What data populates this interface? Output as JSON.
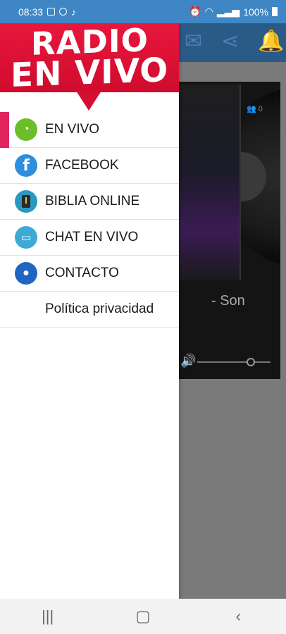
{
  "status_bar": {
    "time": "08:33",
    "battery": "100%"
  },
  "background_app": {
    "listener_count": "0",
    "song_text": "- Son"
  },
  "drawer": {
    "logo": {
      "line1": "RADIO",
      "line2": "EN VIVO"
    },
    "menu": [
      {
        "label": "EN VIVO",
        "icon": "ear-icon",
        "active": true
      },
      {
        "label": "FACEBOOK",
        "icon": "facebook-icon",
        "active": false
      },
      {
        "label": "BIBLIA ONLINE",
        "icon": "bible-icon",
        "active": false
      },
      {
        "label": "CHAT EN VIVO",
        "icon": "chat-icon",
        "active": false
      },
      {
        "label": "CONTACTO",
        "icon": "contact-icon",
        "active": false
      },
      {
        "label": "Política privacidad",
        "icon": "",
        "active": false
      }
    ]
  },
  "colors": {
    "status_bar": "#3f86c4",
    "logo_red": "#e8173c",
    "active_indicator": "#e0245e",
    "scrim": "#7a7a7a"
  },
  "nav_bar": {
    "recents_icon": "recents-icon",
    "home_icon": "home-icon",
    "back_icon": "back-icon"
  }
}
